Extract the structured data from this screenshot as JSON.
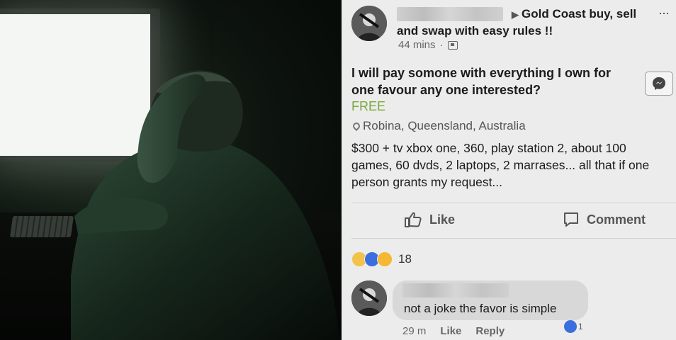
{
  "post": {
    "group_arrow": "▶",
    "group_name": "Gold Coast buy, sell and swap with easy rules !!",
    "time": "44 mins",
    "separator": "·",
    "more": "···",
    "title": "I will pay somone with everything I own for one favour any one interested?",
    "price": "FREE",
    "location": "Robina, Queensland, Australia",
    "body_lines": [
      "$300 + tv xbox one, 360, play station 2, about 100",
      "games, 60 dvds, 2 laptops, 2 marrases... all that if one",
      "person grants my request..."
    ]
  },
  "actions": {
    "like_label": "Like",
    "comment_label": "Comment"
  },
  "reactions": {
    "count": "18"
  },
  "comment": {
    "text": "not a joke the favor is simple",
    "time": "29 m",
    "like_label": "Like",
    "reply_label": "Reply",
    "like_count": "1"
  },
  "colors": {
    "price_green": "#7ba83a",
    "like_blue": "#3b6fe0",
    "panel_bg": "#ececec"
  },
  "icons": {
    "privacy": "group-privacy-icon",
    "location": "location-pin-icon",
    "messenger": "messenger-icon",
    "like": "thumbs-up-icon",
    "comment": "comment-bubble-icon"
  }
}
